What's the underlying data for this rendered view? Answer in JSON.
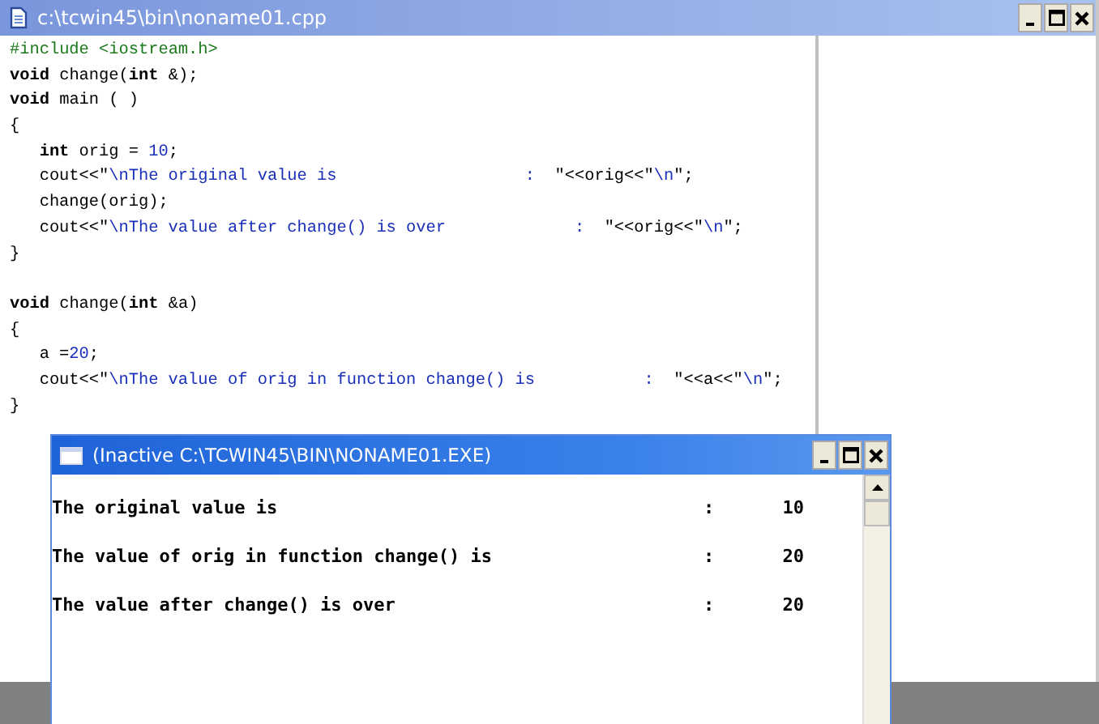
{
  "editor": {
    "title": "c:\\tcwin45\\bin\\noname01.cpp",
    "lines": [
      {
        "kind": "code",
        "tokens": [
          {
            "kind": "preprocessor",
            "text": "#include <iostream.h>"
          }
        ]
      },
      {
        "kind": "code",
        "tokens": [
          {
            "kind": "keyword",
            "text": "void"
          },
          {
            "kind": "plain",
            "text": " change("
          },
          {
            "kind": "keyword",
            "text": "int"
          },
          {
            "kind": "plain",
            "text": " &);"
          }
        ]
      },
      {
        "kind": "code",
        "tokens": [
          {
            "kind": "keyword",
            "text": "void"
          },
          {
            "kind": "plain",
            "text": " main ( )"
          }
        ]
      },
      {
        "kind": "code",
        "tokens": [
          {
            "kind": "plain",
            "text": "{"
          }
        ]
      },
      {
        "kind": "code",
        "indented": true,
        "tokens": [
          {
            "kind": "keyword",
            "text": "int"
          },
          {
            "kind": "plain",
            "text": " orig = "
          },
          {
            "kind": "number",
            "text": "10"
          },
          {
            "kind": "plain",
            "text": ";"
          }
        ]
      },
      {
        "kind": "code",
        "indented": true,
        "tokens": [
          {
            "kind": "plain",
            "text": "cout<<\""
          },
          {
            "kind": "string",
            "text": "\\nThe original value is                   :  "
          },
          {
            "kind": "plain",
            "text": "\"<<orig<<\""
          },
          {
            "kind": "string",
            "text": "\\n"
          },
          {
            "kind": "plain",
            "text": "\";"
          }
        ]
      },
      {
        "kind": "code",
        "indented": true,
        "tokens": [
          {
            "kind": "plain",
            "text": "change(orig);"
          }
        ]
      },
      {
        "kind": "code",
        "indented": true,
        "tokens": [
          {
            "kind": "plain",
            "text": "cout<<\""
          },
          {
            "kind": "string",
            "text": "\\nThe value after change() is over             :  "
          },
          {
            "kind": "plain",
            "text": "\"<<orig<<\""
          },
          {
            "kind": "string",
            "text": "\\n"
          },
          {
            "kind": "plain",
            "text": "\";"
          }
        ]
      },
      {
        "kind": "code",
        "tokens": [
          {
            "kind": "plain",
            "text": "}"
          }
        ]
      },
      {
        "kind": "blank"
      },
      {
        "kind": "code",
        "tokens": [
          {
            "kind": "keyword",
            "text": "void"
          },
          {
            "kind": "plain",
            "text": " change("
          },
          {
            "kind": "keyword",
            "text": "int"
          },
          {
            "kind": "plain",
            "text": " &a)"
          }
        ]
      },
      {
        "kind": "code",
        "tokens": [
          {
            "kind": "plain",
            "text": "{"
          }
        ]
      },
      {
        "kind": "code",
        "indented": true,
        "tokens": [
          {
            "kind": "plain",
            "text": "a ="
          },
          {
            "kind": "number",
            "text": "20"
          },
          {
            "kind": "plain",
            "text": ";"
          }
        ]
      },
      {
        "kind": "code",
        "indented": true,
        "tokens": [
          {
            "kind": "plain",
            "text": "cout<<\""
          },
          {
            "kind": "string",
            "text": "\\nThe value of orig in function change() is           :  "
          },
          {
            "kind": "plain",
            "text": "\"<<a<<\""
          },
          {
            "kind": "string",
            "text": "\\n"
          },
          {
            "kind": "plain",
            "text": "\";"
          }
        ]
      },
      {
        "kind": "code",
        "tokens": [
          {
            "kind": "plain",
            "text": "}"
          }
        ]
      }
    ]
  },
  "output_window": {
    "title": "(Inactive C:\\TCWIN45\\BIN\\NONAME01.EXE)",
    "rows": [
      {
        "label": "The original value is",
        "separator": ":",
        "value": "10"
      },
      {
        "label": "The value of orig in function change() is",
        "separator": ":",
        "value": "20"
      },
      {
        "label": "The value after change() is over",
        "separator": ":",
        "value": "20"
      }
    ]
  }
}
